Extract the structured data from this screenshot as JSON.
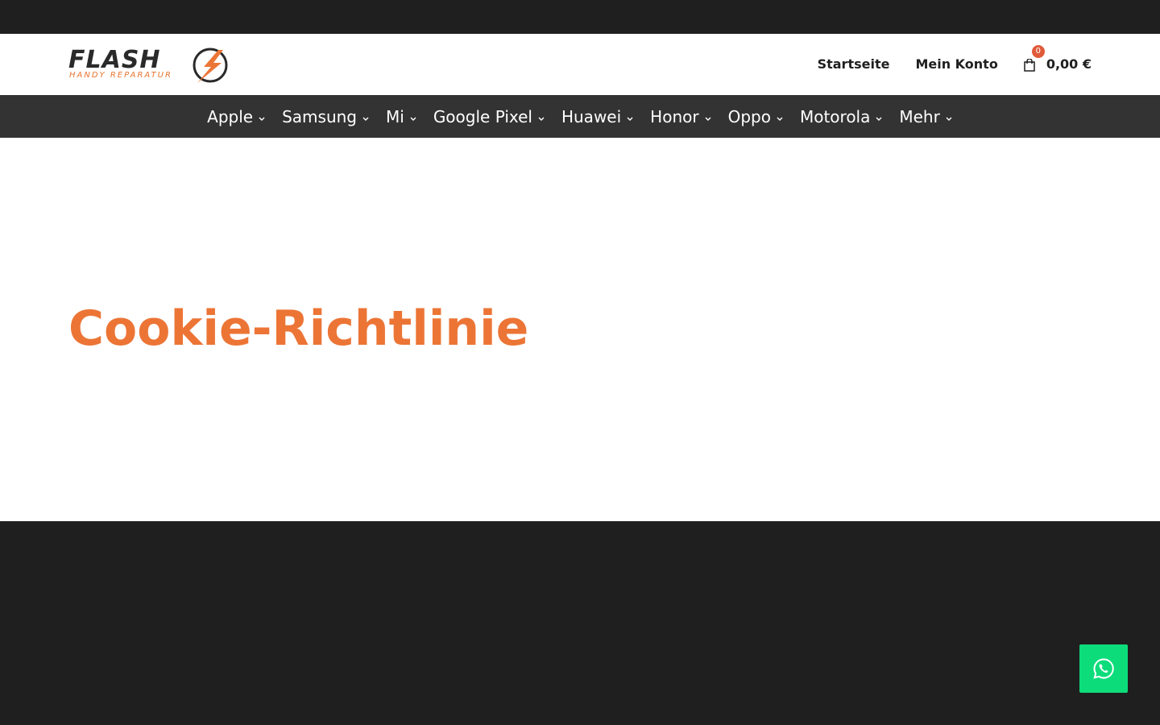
{
  "brand": {
    "name": "FLASH",
    "tagline": "HANDY REPARATUR",
    "accent_color": "#ec7536",
    "dark_color": "#1f1f1f",
    "nav_color": "#333333",
    "whatsapp_color": "#0ddc7b"
  },
  "header": {
    "links": [
      {
        "label": "Startseite"
      },
      {
        "label": "Mein Konto"
      }
    ],
    "cart": {
      "icon": "shopping-bag-icon",
      "count": "0",
      "total": "0,00 €"
    }
  },
  "categories": [
    {
      "label": "Apple"
    },
    {
      "label": "Samsung"
    },
    {
      "label": "Mi"
    },
    {
      "label": "Google Pixel"
    },
    {
      "label": "Huawei"
    },
    {
      "label": "Honor"
    },
    {
      "label": "Oppo"
    },
    {
      "label": "Motorola"
    },
    {
      "label": "Mehr"
    }
  ],
  "main": {
    "title": "Cookie-Richtlinie"
  },
  "floating": {
    "whatsapp_icon": "whatsapp-icon"
  }
}
